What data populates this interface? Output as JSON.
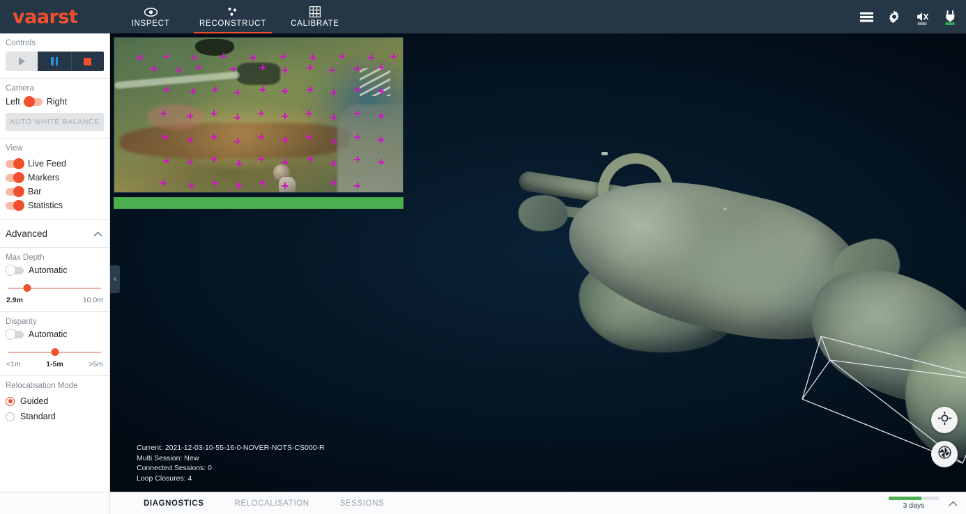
{
  "app": {
    "brand": "vaarst",
    "brand_color": "#f1502f"
  },
  "header": {
    "tabs": [
      {
        "label": "INSPECT",
        "icon": "eye-icon",
        "active": false
      },
      {
        "label": "RECONSTRUCT",
        "icon": "point-cloud-icon",
        "active": true
      },
      {
        "label": "CALIBRATE",
        "icon": "grid-icon",
        "active": false
      }
    ],
    "icons": [
      {
        "name": "list-icon"
      },
      {
        "name": "gear-icon"
      },
      {
        "name": "speaker-muted-icon",
        "status_color": "#8b949c"
      },
      {
        "name": "power-plug-icon",
        "status_color": "#2fa84f"
      }
    ]
  },
  "sidebar": {
    "controls": {
      "title": "Controls",
      "play_label": "Play",
      "pause_label": "Pause",
      "stop_label": "Stop"
    },
    "camera": {
      "title": "Camera",
      "left_label": "Left",
      "right_label": "Right",
      "selected": "Left",
      "white_balance_label": "AUTO WHITE BALANCE"
    },
    "view": {
      "title": "View",
      "items": [
        {
          "label": "Live Feed",
          "on": true
        },
        {
          "label": "Markers",
          "on": true
        },
        {
          "label": "Bar",
          "on": true
        },
        {
          "label": "Statistics",
          "on": true
        }
      ]
    },
    "advanced": {
      "title": "Advanced",
      "expanded": true,
      "max_depth": {
        "title": "Max Depth",
        "auto_label": "Automatic",
        "auto_on": false,
        "value": "2.9m",
        "max_label": "10.0m",
        "position_pct": 20
      },
      "disparity": {
        "title": "Disparity",
        "auto_label": "Automatic",
        "auto_on": false,
        "min_label": "<1m",
        "value": "1-5m",
        "max_label": ">5m",
        "position_pct": 50
      },
      "relocalisation": {
        "title": "Relocalisation Mode",
        "options": [
          {
            "label": "Guided",
            "selected": true
          },
          {
            "label": "Standard",
            "selected": false
          }
        ]
      }
    }
  },
  "viewport": {
    "collapse_chevron": "‹",
    "status": {
      "current": "Current: 2021-12-03-10-55-16-0-NOVER-NOTS-CS000-R",
      "multi_session": "Multi Session: New",
      "connected_sessions": "Connected Sessions: 0",
      "loop_closures": "Loop Closures: 4"
    },
    "buttons": [
      {
        "name": "recenter-view-button",
        "icon": "crosshair-icon"
      },
      {
        "name": "capture-button",
        "icon": "aperture-icon"
      }
    ]
  },
  "bottom": {
    "tabs": [
      {
        "label": "DIAGNOSTICS",
        "active": true
      },
      {
        "label": "RELOCALISATION",
        "active": false
      },
      {
        "label": "SESSIONS",
        "active": false
      }
    ],
    "progress": {
      "label": "3 days",
      "percent": 65,
      "color": "#4caf50"
    },
    "expand_chevron": "˄"
  }
}
